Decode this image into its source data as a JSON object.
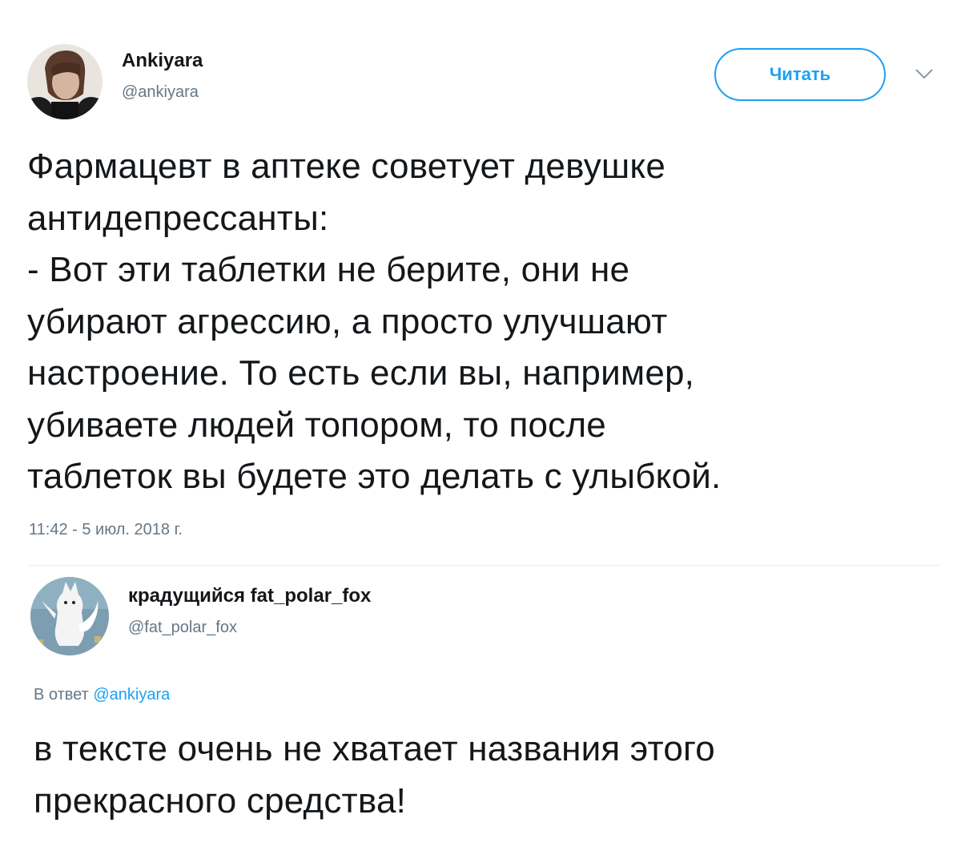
{
  "original_tweet": {
    "author": {
      "display_name": "Ankiyara",
      "handle": "@ankiyara"
    },
    "follow_button_label": "Читать",
    "menu_icon": "chevron-down-icon",
    "text": "Фармацевт в аптеке советует девушке\nантидепрессанты:\n- Вот эти таблетки не берите, они не\nубирают агрессию, а просто улучшают\nнастроение. То есть если вы, например,\nубиваете людей топором, то после\nтаблеток вы будете это делать с улыбкой.",
    "timestamp": "11:42 - 5 июл. 2018 г."
  },
  "reply_tweet": {
    "author": {
      "display_name": "крадущийся fat_polar_fox",
      "handle": "@fat_polar_fox"
    },
    "reply_to_prefix": "В ответ",
    "reply_to_handle": "@ankiyara",
    "text": "в тексте очень не хватает названия этого\nпрекрасного средства!"
  },
  "colors": {
    "accent": "#1da1f2",
    "text": "#14171a",
    "secondary_text": "#657786",
    "divider": "#e6ecf0"
  }
}
